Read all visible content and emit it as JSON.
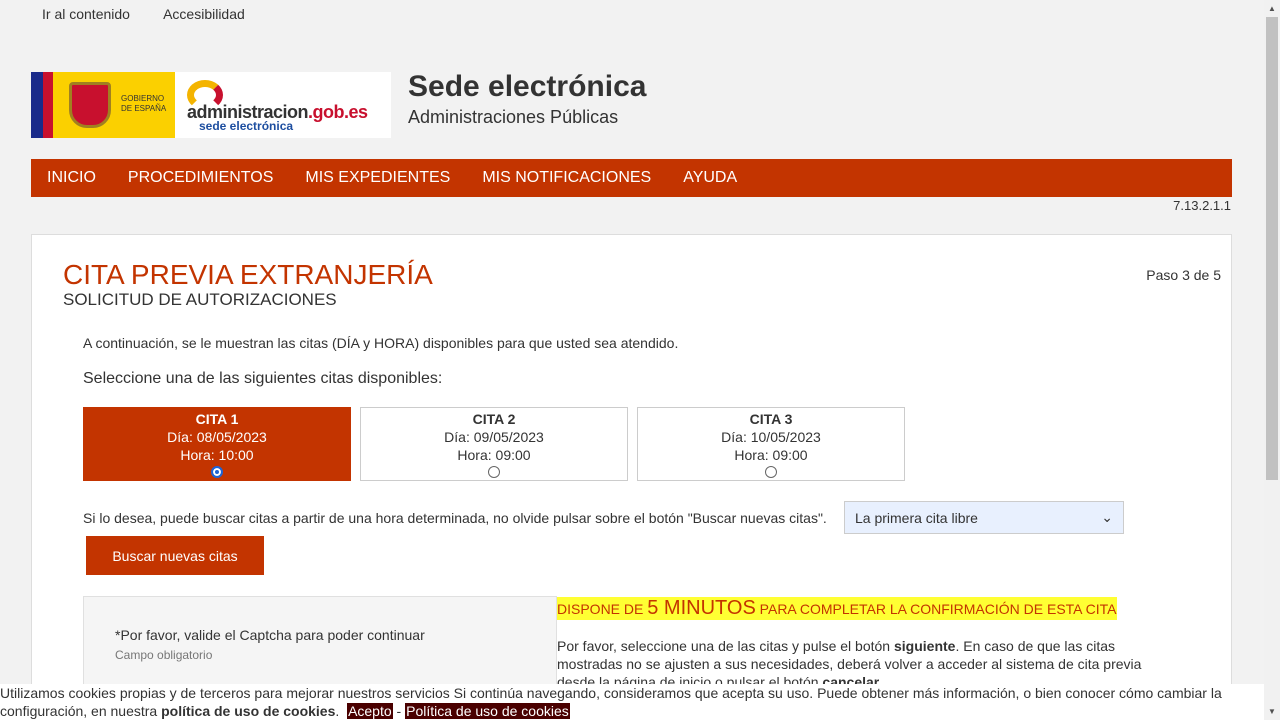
{
  "skip": {
    "content": "Ir al contenido",
    "access": "Accesibilidad"
  },
  "logo": {
    "gob_line1": "GOBIERNO",
    "gob_line2": "DE ESPAÑA",
    "admin_a": "administracion",
    "admin_b": ".gob.es",
    "admin_sub": "sede electrónica"
  },
  "header": {
    "title": "Sede electrónica",
    "subtitle": "Administraciones Públicas"
  },
  "nav": [
    "INICIO",
    "PROCEDIMIENTOS",
    "MIS EXPEDIENTES",
    "MIS NOTIFICACIONES",
    "AYUDA"
  ],
  "version": "7.13.2.1.1",
  "main": {
    "title": "CITA PREVIA EXTRANJERÍA",
    "subtitle": "SOLICITUD DE AUTORIZACIONES",
    "step": "Paso 3 de 5",
    "intro": "A continuación, se le muestran las citas (DÍA y HORA) disponibles para que usted sea atendido.",
    "select_title": "Seleccione una de las siguientes citas disponibles:"
  },
  "citas": [
    {
      "label": "CITA 1",
      "dia": "Día: 08/05/2023",
      "hora": "Hora: 10:00",
      "selected": true
    },
    {
      "label": "CITA 2",
      "dia": "Día: 09/05/2023",
      "hora": "Hora: 09:00",
      "selected": false
    },
    {
      "label": "CITA 3",
      "dia": "Día: 10/05/2023",
      "hora": "Hora: 09:00",
      "selected": false
    }
  ],
  "buscar": {
    "text": "Si lo desea, puede buscar citas a partir de una hora determinada, no olvide pulsar sobre el botón \"Buscar nuevas citas\".",
    "select_value": "La primera cita libre",
    "button": "Buscar nuevas citas"
  },
  "captcha": {
    "message": "*Por favor, valide el Captcha para poder continuar",
    "required": "Campo obligatorio"
  },
  "timer": {
    "pre": "DISPONE DE ",
    "big": "5 MINUTOS",
    "post": " PARA COMPLETAR LA CONFIRMACIÓN DE ESTA CITA"
  },
  "info": {
    "p1": "Por favor, seleccione una de las citas y pulse el botón ",
    "siguiente": "siguiente",
    "p2": ". En caso de que las citas mostradas no se ajusten a sus necesidades, deberá volver a acceder al sistema de cita previa desde la página de inicio o pulsar el botón ",
    "cancelar": "cancelar"
  },
  "cookies": {
    "text": "Utilizamos cookies propias y de terceros para mejorar nuestros servicios Si continúa navegando, consideramos que acepta su uso. Puede obtener más información, o bien conocer cómo cambiar la configuración, en nuestra ",
    "policy": "política de uso de cookies",
    "dot": ".",
    "accept": "Acepto",
    "sep": " - ",
    "policy_btn": "Política de uso de cookies"
  }
}
